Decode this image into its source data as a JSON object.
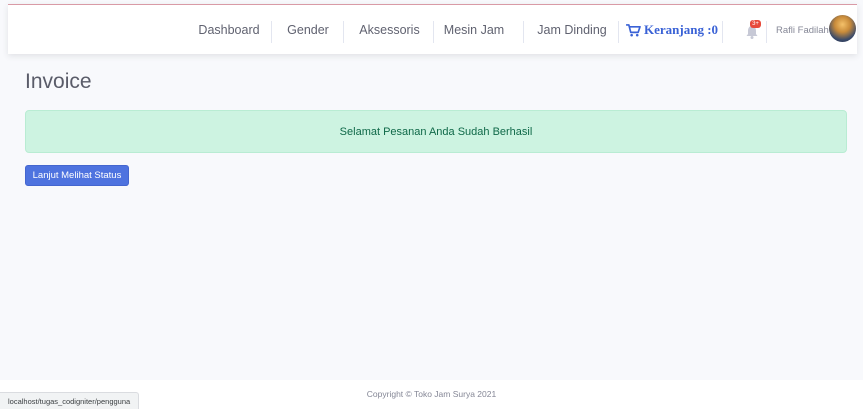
{
  "navbar": {
    "items": [
      {
        "label": "Dashboard"
      },
      {
        "label": "Gender"
      },
      {
        "label": "Aksessoris"
      },
      {
        "label": "Mesin Jam"
      },
      {
        "label": "Jam Dinding"
      }
    ],
    "cart_label": "Keranjang :0",
    "notification_badge": "3+",
    "user_name": "Rafli Fadilah"
  },
  "main": {
    "title": "Invoice",
    "alert_text": "Selamat Pesanan Anda Sudah Berhasil",
    "button_label": "Lanjut Melihat Status"
  },
  "footer": {
    "copyright": "Copyright © Toko Jam Surya 2021"
  },
  "status_bar": {
    "url": "localhost/tugas_codigniter/pengguna"
  },
  "colors": {
    "primary": "#4e73df",
    "alert_bg": "#cdf3e1",
    "alert_text": "#0f6848",
    "badge": "#e74a3b",
    "page_bg": "#f8f9fc"
  },
  "icons": [
    "shopping-cart-icon",
    "bell-icon",
    "user-avatar"
  ]
}
